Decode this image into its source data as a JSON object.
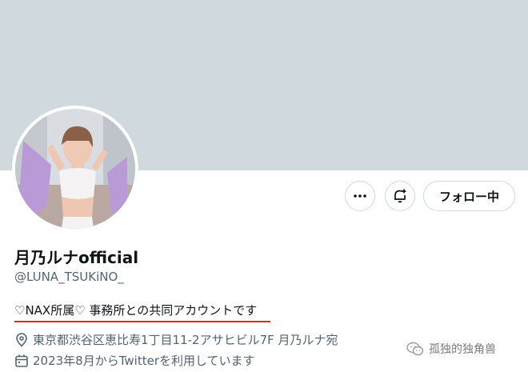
{
  "profile": {
    "display_name": "月乃ルナofficial",
    "handle": "@LUNA_TSUKiNO_",
    "bio": "♡NAX所属♡  事務所との共同アカウントです",
    "location": "東京都渋谷区恵比寿1丁目11-2アサヒビル7F  月乃ルナ宛",
    "joined": "2023年8月からTwitterを利用しています"
  },
  "actions": {
    "more_label": "•••",
    "follow_label": "フォロー中"
  },
  "icons": {
    "more": "more-icon",
    "notify": "bell-plus-icon",
    "location": "location-pin-icon",
    "calendar": "calendar-icon"
  },
  "watermark": {
    "text": "孤独的独角兽"
  },
  "colors": {
    "banner": "#cfd9de",
    "text": "#0f1419",
    "secondary_text": "#536471",
    "underline": "#e0291e"
  }
}
